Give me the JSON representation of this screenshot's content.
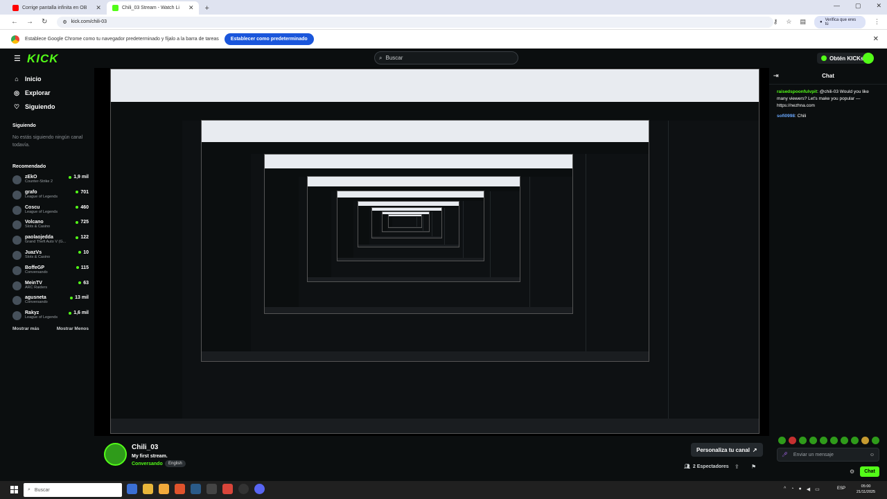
{
  "browser": {
    "tabs": [
      {
        "title": "Corrige pantalla infinita en OB",
        "favicon_color": "#ff0000"
      },
      {
        "title": "Chili_03 Stream - Watch Li",
        "favicon_color": "#53fc18"
      }
    ],
    "url": "kick.com/chili-03",
    "verify_label": "Verifica que eres tú",
    "infobar_text": "Establece Google Chrome como tu navegador predeterminado y fíjalo a la barra de tareas",
    "infobar_button": "Establecer como predeterminado"
  },
  "kick": {
    "logo": "KICK",
    "search_placeholder": "Buscar",
    "kicks_button": "Obtén KICKs",
    "nav": [
      {
        "label": "Inicio",
        "icon": "home-icon"
      },
      {
        "label": "Explorar",
        "icon": "compass-icon"
      },
      {
        "label": "Siguiendo",
        "icon": "heart-icon"
      }
    ],
    "following_title": "Siguiendo",
    "following_empty": "No estás siguiendo ningún canal todavía.",
    "recommended_title": "Recomendado",
    "channels": [
      {
        "name": "zEkO",
        "category": "Counter-Strike 2",
        "viewers": "1,9 mil"
      },
      {
        "name": "grafo",
        "category": "League of Legends",
        "viewers": "701"
      },
      {
        "name": "Coscu",
        "category": "League of Legends",
        "viewers": "460"
      },
      {
        "name": "Volcano",
        "category": "Slots & Casino",
        "viewers": "725"
      },
      {
        "name": "paolaojedda",
        "category": "Grand Theft Auto V (G...",
        "viewers": "122"
      },
      {
        "name": "JuazVs",
        "category": "Slots & Casino",
        "viewers": "10"
      },
      {
        "name": "BoffeGP",
        "category": "Conversando",
        "viewers": "115"
      },
      {
        "name": "MeinTV",
        "category": "ARC Raiders",
        "viewers": "63"
      },
      {
        "name": "agusneta",
        "category": "Conversando",
        "viewers": "13 mil"
      },
      {
        "name": "Rakyz",
        "category": "League of Legends",
        "viewers": "1,6 mil"
      }
    ],
    "show_more": "Mostrar más",
    "show_less": "Mostrar Menos",
    "streamer": {
      "name": "Chili_03",
      "title": "My first stream.",
      "category": "Conversando",
      "language": "English",
      "customize": "Personaliza tu canal",
      "viewers": "2 Espectadores"
    },
    "chat": {
      "title": "Chat",
      "messages": [
        {
          "user": "raisedspoonfulvpit",
          "text": ": @chili-03 Would you like many viewers? Let's make you popular — https://nezhna.com"
        },
        {
          "user": "sofi0998",
          "text": ": Chili"
        }
      ],
      "input_placeholder": "Enviar un mensaje",
      "send": "Chat"
    }
  },
  "taskbar": {
    "search": "Buscar",
    "lang": "ESP",
    "time": "05:00",
    "date": "21/11/2025"
  },
  "colors": {
    "accent": "#53fc18",
    "background": "#0b0e0f"
  }
}
